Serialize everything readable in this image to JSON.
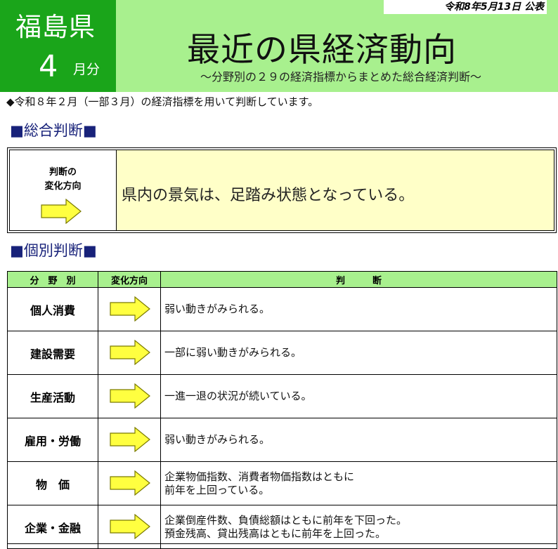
{
  "header": {
    "prefecture": "福島県",
    "month_number": "4",
    "month_unit": "月分",
    "publication_date": "令和8年5月13日 公表",
    "title": "最近の県経済動向",
    "subtitle": "～分野別の２９の経済指標からまとめた総合経済判断～"
  },
  "note": "◆令和８年２月（一部３月）の経済指標を用いて判断しています。",
  "overall_section": {
    "heading": "■総合判断■",
    "label_line1": "判断の",
    "label_line2": "変化方向",
    "direction": "right-arrow-icon",
    "judgement": "県内の景気は、足踏み状態となっている。"
  },
  "individual_section": {
    "heading": "■個別判断■",
    "columns": [
      "分　野　別",
      "変化方向",
      "判　　　断"
    ],
    "rows": [
      {
        "category": "個人消費",
        "direction": "right-arrow-icon",
        "line1": "弱い動きがみられる。",
        "line2": ""
      },
      {
        "category": "建設需要",
        "direction": "right-arrow-icon",
        "line1": "一部に弱い動きがみられる。",
        "line2": ""
      },
      {
        "category": "生産活動",
        "direction": "right-arrow-icon",
        "line1": "一進一退の状況が続いている。",
        "line2": ""
      },
      {
        "category": "雇用・労働",
        "direction": "right-arrow-icon",
        "line1": "弱い動きがみられる。",
        "line2": ""
      },
      {
        "category": "物　価",
        "direction": "right-arrow-icon",
        "line1": "企業物価指数、消費者物価指数はともに",
        "line2": "前年を上回っている。"
      },
      {
        "category": "企業・金融",
        "direction": "right-arrow-icon",
        "line1": "企業倒産件数、負債総額はともに前年を下回った。",
        "line2": "預金残高、貸出残高はともに前年を上回った。"
      }
    ]
  },
  "colors": {
    "header_bg": "#a8f08e",
    "prefecture_box": "#1aa51a",
    "overall_bg": "#ffffc8",
    "section_heading": "#18227a",
    "arrow_fill": "#ffff40"
  }
}
